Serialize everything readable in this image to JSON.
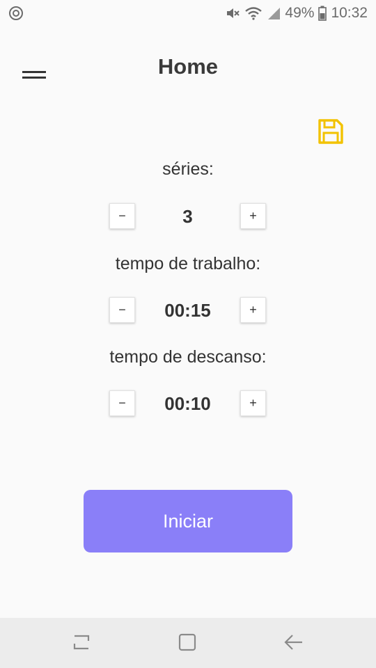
{
  "status_bar": {
    "battery": "49%",
    "time": "10:32",
    "icons": [
      "sync-icon",
      "mute-icon",
      "wifi-icon",
      "signal-icon",
      "battery-icon"
    ]
  },
  "header": {
    "title": "Home",
    "menu_icon": "hamburger-menu-icon"
  },
  "toolbar": {
    "save_icon": "save-icon",
    "save_color": "#f2c200"
  },
  "settings": [
    {
      "label": "séries:",
      "value": "3",
      "minus": "−",
      "plus": "+"
    },
    {
      "label": "tempo de trabalho:",
      "value": "00:15",
      "minus": "−",
      "plus": "+"
    },
    {
      "label": "tempo de descanso:",
      "value": "00:10",
      "minus": "−",
      "plus": "+"
    }
  ],
  "start_button": {
    "label": "Iniciar",
    "color": "#8a7ff8"
  },
  "nav_bar": {
    "icons": [
      "recent-apps-icon",
      "home-icon",
      "back-icon"
    ]
  }
}
